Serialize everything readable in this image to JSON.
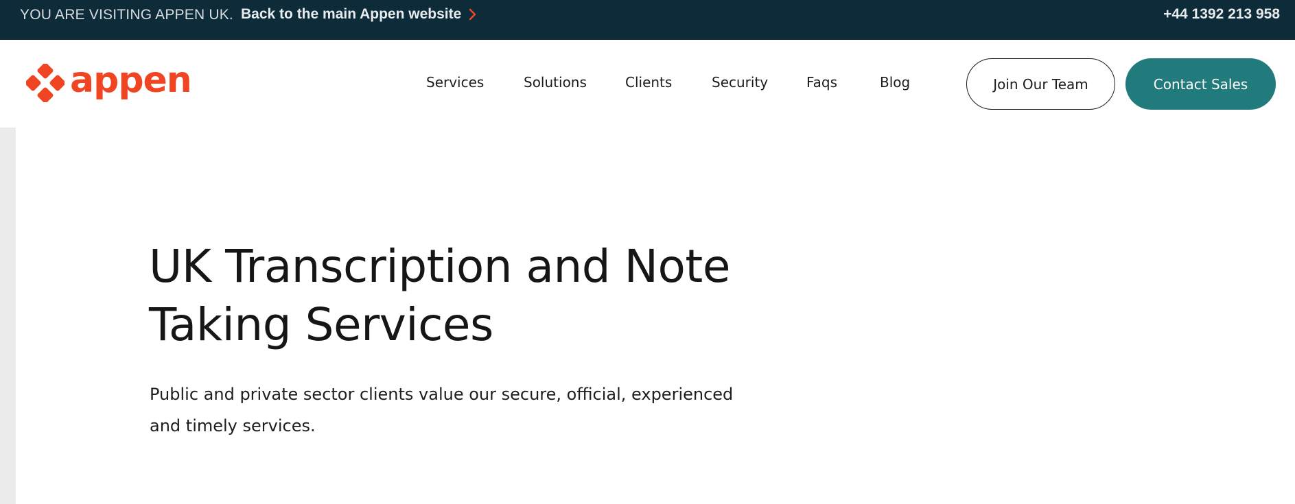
{
  "topbar": {
    "visiting_text": "YOU ARE VISITING APPEN UK.",
    "back_link_text": "Back to the main Appen website",
    "phone": "+44 1392 213 958",
    "background_color": "#0d2b38",
    "accent_color": "#ef4523",
    "chevron_icon": "chevron-right-icon"
  },
  "header": {
    "logo": {
      "word": "appen",
      "color": "#ef4523",
      "icon": "appen-diamond-logo-icon"
    },
    "nav": [
      {
        "label": "Services"
      },
      {
        "label": "Solutions"
      },
      {
        "label": "Clients"
      },
      {
        "label": "Security"
      },
      {
        "label": "Faqs"
      },
      {
        "label": "Blog"
      }
    ],
    "join_button": "Join Our Team",
    "contact_button": "Contact Sales",
    "contact_button_color": "#217a7b"
  },
  "hero": {
    "title_line1": "UK Transcription and Note",
    "title_line2": "Taking Services",
    "subtitle_line1": "Public and private sector clients value our secure, official, experienced",
    "subtitle_line2": "and timely services."
  }
}
